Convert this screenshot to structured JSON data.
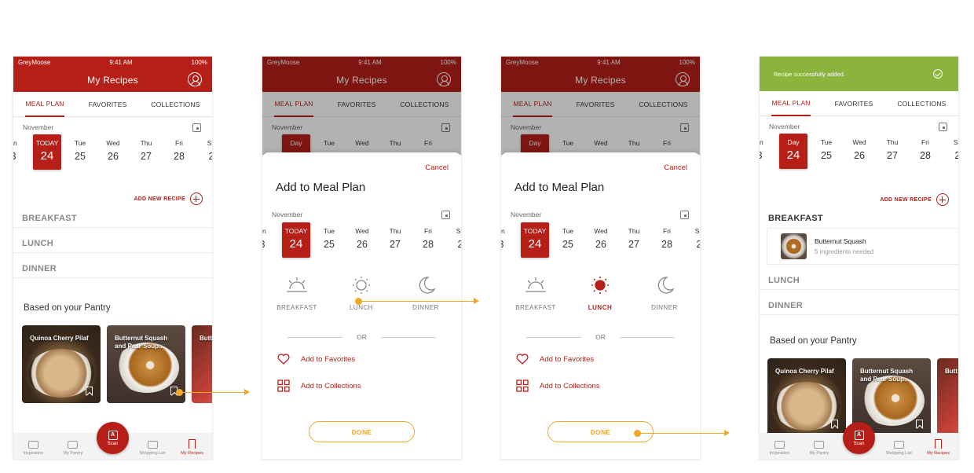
{
  "status": {
    "carrier": "GreyMoose",
    "time": "9:41 AM",
    "battery": "100%"
  },
  "app": {
    "title": "My Recipes"
  },
  "tabs": [
    "MEAL PLAN",
    "FAVORITES",
    "COLLECTIONS"
  ],
  "calendar": {
    "month": "November",
    "prev_day": {
      "name": "un",
      "date": "3"
    },
    "today_label": "TODAY",
    "day_label": "Day",
    "today_date": "24",
    "days": [
      {
        "name": "Tue",
        "date": "25"
      },
      {
        "name": "Wed",
        "date": "26"
      },
      {
        "name": "Thu",
        "date": "27"
      },
      {
        "name": "Fri",
        "date": "28"
      },
      {
        "name": "Sa",
        "date": "2"
      }
    ]
  },
  "add_new_recipe": "ADD NEW RECIPE",
  "meals": {
    "breakfast": "BREAKFAST",
    "lunch": "LUNCH",
    "dinner": "DINNER"
  },
  "pantry": {
    "title": "Based on your Pantry",
    "cards": [
      {
        "label": "Quinoa Cherry Pilaf"
      },
      {
        "label": "Butternut Squash and Pear Soup..."
      },
      {
        "label": "Butt and"
      }
    ]
  },
  "bottom_nav": {
    "inspiration": "Inspiration",
    "pantry": "My Pantry",
    "scan": "Scan",
    "shopping": "Shopping List",
    "recipes": "My Recipes"
  },
  "sheet": {
    "cancel": "Cancel",
    "title": "Add to Meal Plan",
    "or": "OR",
    "favorites": "Add to Favorites",
    "collections": "Add to Collections",
    "done": "DONE"
  },
  "toast": {
    "message": "Recipe successfully added."
  },
  "added_recipe": {
    "name": "Butternut Squash",
    "subtitle": "5 Ingredients needed"
  },
  "colors": {
    "brand": "#b51f17",
    "accent": "#f0a828",
    "success": "#8ab43c"
  }
}
